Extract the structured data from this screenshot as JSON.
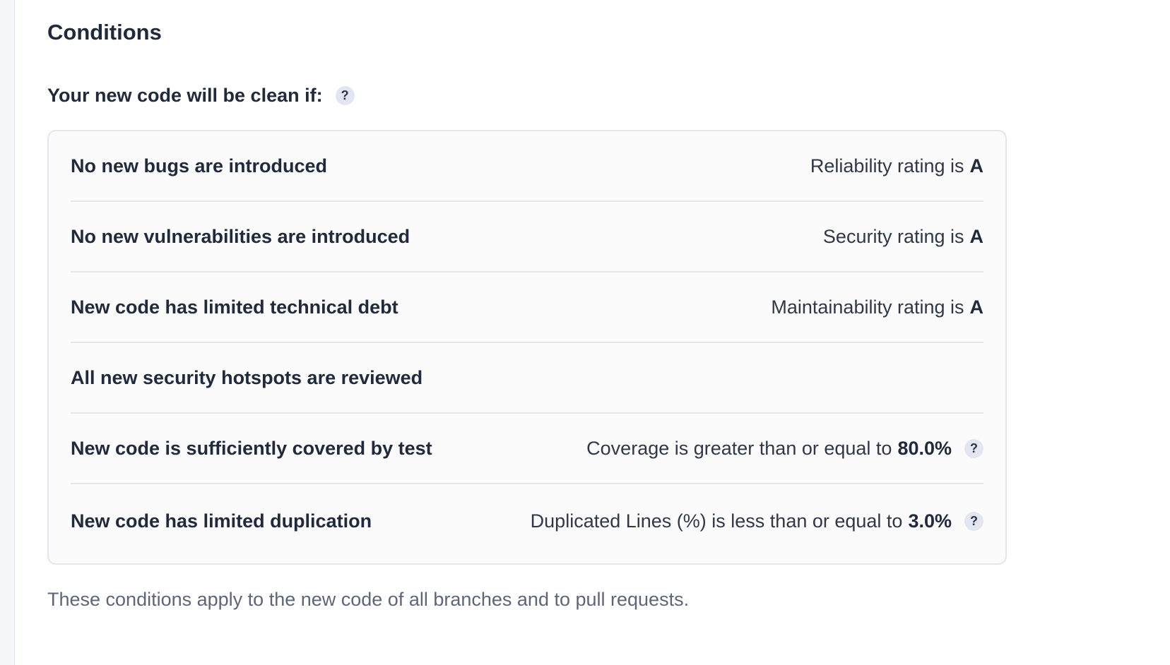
{
  "section": {
    "title": "Conditions",
    "subtitle": "Your new code will be clean if:",
    "subtitle_help_icon": "?"
  },
  "conditions": [
    {
      "label": "No new bugs are introduced",
      "metric": "Reliability rating is",
      "value": "A",
      "help": ""
    },
    {
      "label": "No new vulnerabilities are introduced",
      "metric": "Security rating is",
      "value": "A",
      "help": ""
    },
    {
      "label": "New code has limited technical debt",
      "metric": "Maintainability rating is",
      "value": "A",
      "help": ""
    },
    {
      "label": "All new security hotspots are reviewed",
      "metric": "",
      "value": "",
      "help": ""
    },
    {
      "label": "New code is sufficiently covered by test",
      "metric": "Coverage is greater than or equal to",
      "value": "80.0%",
      "help": "?"
    },
    {
      "label": "New code has limited duplication",
      "metric": "Duplicated Lines (%) is less than or equal to",
      "value": "3.0%",
      "help": "?"
    }
  ],
  "footer": {
    "text": "These conditions apply to the new code of all branches and to pull requests."
  },
  "colors": {
    "text": "#212a3c",
    "muted": "#5d6679",
    "border": "#e4e6ec",
    "help_bg": "#e3e6f2"
  },
  "icons": {
    "help": "help-icon"
  }
}
